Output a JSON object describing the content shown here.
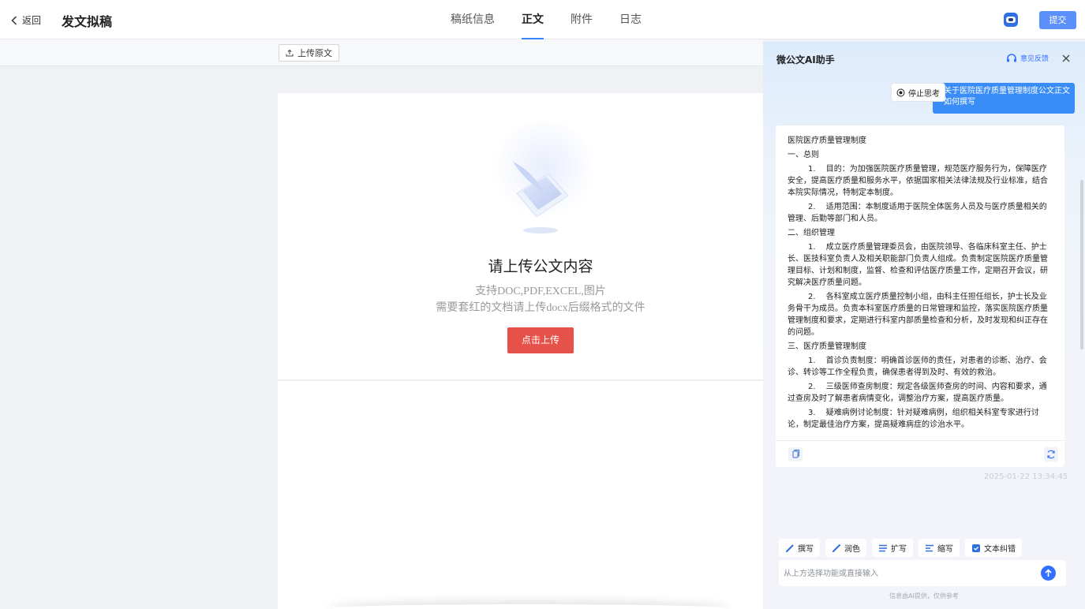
{
  "header": {
    "back_label": "返回",
    "title": "发文拟稿",
    "tabs": [
      {
        "label": "稿纸信息",
        "active": false
      },
      {
        "label": "正文",
        "active": true
      },
      {
        "label": "附件",
        "active": false
      },
      {
        "label": "日志",
        "active": false
      }
    ],
    "submit_label": "提交"
  },
  "editor": {
    "upload_original_label": "上传原文",
    "upload_title": "请上传公文内容",
    "upload_hint_formats": "支持DOC,PDF,EXCEL,图片",
    "upload_hint_docx": "需要套红的文档请上传docx后缀格式的文件",
    "click_upload_label": "点击上传"
  },
  "ai_panel": {
    "title": "微公文AI助手",
    "feedback_label": "意见反馈",
    "stop_label": "停止思考",
    "user_question": "关于医院医疗质量管理制度公文正文如何撰写",
    "answer": {
      "title": "医院医疗质量管理制度",
      "sec1": "一、总则",
      "sec1_p1": "1.　 目的：为加强医院医疗质量管理，规范医疗服务行为，保障医疗安全，提高医疗质量和服务水平，依据国家相关法律法规及行业标准，结合本院实际情况，特制定本制度。",
      "sec1_p2": "2.　 适用范围：本制度适用于医院全体医务人员及与医疗质量相关的管理、后勤等部门和人员。",
      "sec2": "二、组织管理",
      "sec2_p1": "1.　 成立医疗质量管理委员会，由医院领导、各临床科室主任、护士长、医技科室负责人及相关职能部门负责人组成。负责制定医院医疗质量管理目标、计划和制度，监督、检查和评估医疗质量工作，定期召开会议，研究解决医疗质量问题。",
      "sec2_p2": "2.　 各科室成立医疗质量控制小组，由科主任担任组长，护士长及业务骨干为成员。负责本科室医疗质量的日常管理和监控，落实医院医疗质量管理制度和要求，定期进行科室内部质量检查和分析，及时发现和纠正存在的问题。",
      "sec3": "三、医疗质量管理制度",
      "sec3_p1": "1.　 首诊负责制度：明确首诊医师的责任，对患者的诊断、治疗、会诊、转诊等工作全程负责，确保患者得到及时、有效的救治。",
      "sec3_p2": "2.　 三级医师查房制度：规定各级医师查房的时间、内容和要求，通过查房及时了解患者病情变化，调整治疗方案，提高医疗质量。",
      "sec3_p3": "3.　 疑难病例讨论制度：针对疑难病例，组织相关科室专家进行讨论，制定最佳治疗方案，提高疑难病症的诊治水平。"
    },
    "timestamp": "2025-01-22 13:34:45",
    "functions": [
      "撰写",
      "润色",
      "扩写",
      "缩写",
      "文本纠错"
    ],
    "input_placeholder": "从上方选择功能或直接输入",
    "disclaimer": "信息由AI提供，仅供参考",
    "accent_color": "#3370ff"
  }
}
